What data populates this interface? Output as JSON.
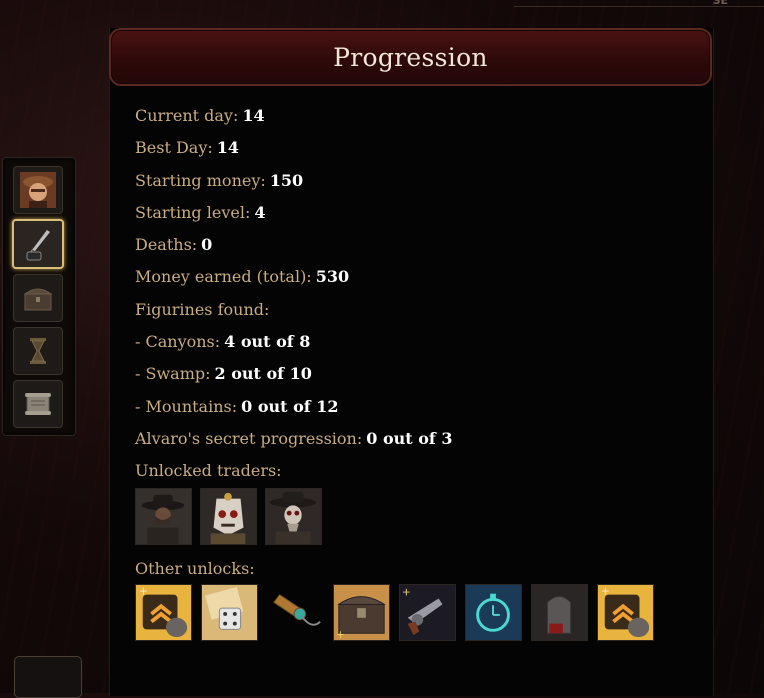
{
  "window": {
    "title": "Progression",
    "compass_label": "SE"
  },
  "stats": [
    {
      "label": "Current day:",
      "value": "14"
    },
    {
      "label": "Best Day:",
      "value": "14"
    },
    {
      "label": "Starting money:",
      "value": "150"
    },
    {
      "label": "Starting level:",
      "value": "4"
    },
    {
      "label": "Deaths:",
      "value": "0"
    },
    {
      "label": "Money earned (total):",
      "value": "530"
    },
    {
      "label": "Figurines found:",
      "value": ""
    },
    {
      "label": "- Canyons:",
      "value": "4 out of 8"
    },
    {
      "label": "- Swamp:",
      "value": "2 out of 10"
    },
    {
      "label": "- Mountains:",
      "value": "0 out of 12"
    },
    {
      "label": "Alvaro's secret progression:",
      "value": "0 out of 3"
    }
  ],
  "traders": {
    "heading": "Unlocked traders:",
    "icons": [
      "cowboy-trader-icon",
      "skull-mask-trader-icon",
      "skeleton-hat-trader-icon"
    ]
  },
  "unlocks": {
    "heading": "Other unlocks:",
    "icons": [
      "money-bag-upgrade-icon",
      "dice-scroll-icon",
      "spyglass-icon",
      "treasure-chest-icon",
      "revolver-icon",
      "pocket-watch-icon",
      "tombstone-icon",
      "money-bag-upgrade-icon"
    ]
  },
  "side_tabs": [
    "character-portrait-icon",
    "quill-inkwell-icon",
    "chest-icon",
    "hourglass-icon",
    "scroll-icon"
  ]
}
